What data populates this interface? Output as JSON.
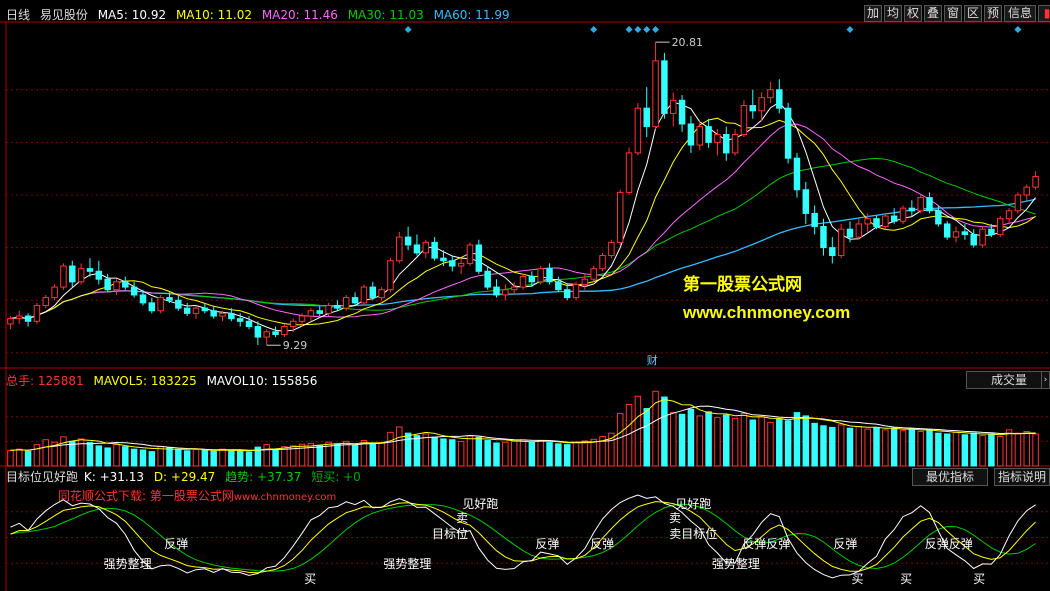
{
  "header": {
    "period": "日线",
    "stock_name": "易见股份",
    "ma": [
      {
        "label": "MA5: 10.92",
        "color": "#ffffff"
      },
      {
        "label": "MA10: 11.02",
        "color": "#ffff00"
      },
      {
        "label": "MA20: 11.46",
        "color": "#ff66ff"
      },
      {
        "label": "MA30: 11.03",
        "color": "#00cc00"
      },
      {
        "label": "MA60: 11.99",
        "color": "#33bbff"
      }
    ]
  },
  "toolbar": {
    "buttons": [
      "加",
      "均",
      "权",
      "叠",
      "窗",
      "区",
      "预",
      "信息"
    ],
    "flags": [
      "▮",
      "▮"
    ]
  },
  "watermark": {
    "line1": "第一股票公式网",
    "line2": "www.chnmoney.com",
    "color": "#ffff00"
  },
  "volume_panel": {
    "label_total": "总手: 125881",
    "label_mavol5": "MAVOL5: 183225",
    "label_mavol10": "MAVOL10: 155856",
    "selector": "成交量"
  },
  "indicator_panel": {
    "name": "目标位见好跑",
    "k": "K: +31.13",
    "d": "D: +29.47",
    "trend": "趋势: +37.37",
    "short_buy": "短买: +0",
    "btn_optimal": "最优指标",
    "btn_desc": "指标说明",
    "promo_red": "同花顺公式下载: 第一股票公式网",
    "promo_url": "www.chnmoney.com"
  },
  "chart_data": {
    "type": "candlestick",
    "price_annotations": {
      "high": "20.81",
      "low": "9.29"
    },
    "finance_marker": "财",
    "ohlc_series": [
      [
        10.1,
        10.4,
        9.9,
        10.3
      ],
      [
        10.3,
        10.6,
        10.1,
        10.4
      ],
      [
        10.4,
        10.5,
        10.0,
        10.2
      ],
      [
        10.2,
        10.9,
        10.1,
        10.8
      ],
      [
        10.8,
        11.2,
        10.7,
        11.1
      ],
      [
        11.1,
        11.6,
        11.0,
        11.5
      ],
      [
        11.5,
        12.4,
        11.4,
        12.3
      ],
      [
        12.3,
        12.5,
        11.5,
        11.7
      ],
      [
        11.7,
        12.4,
        11.6,
        12.2
      ],
      [
        12.2,
        12.6,
        11.9,
        12.1
      ],
      [
        12.1,
        12.5,
        11.6,
        11.8
      ],
      [
        11.8,
        12.0,
        11.3,
        11.4
      ],
      [
        11.4,
        11.8,
        11.2,
        11.7
      ],
      [
        11.7,
        11.9,
        11.4,
        11.5
      ],
      [
        11.5,
        11.7,
        11.1,
        11.2
      ],
      [
        11.2,
        11.4,
        10.8,
        10.9
      ],
      [
        10.9,
        11.1,
        10.5,
        10.6
      ],
      [
        10.6,
        11.2,
        10.5,
        11.1
      ],
      [
        11.1,
        11.3,
        10.9,
        11.0
      ],
      [
        11.0,
        11.2,
        10.6,
        10.7
      ],
      [
        10.7,
        10.9,
        10.4,
        10.5
      ],
      [
        10.5,
        10.8,
        10.3,
        10.7
      ],
      [
        10.7,
        10.9,
        10.5,
        10.6
      ],
      [
        10.6,
        10.8,
        10.3,
        10.4
      ],
      [
        10.4,
        10.6,
        10.2,
        10.5
      ],
      [
        10.5,
        10.7,
        10.2,
        10.3
      ],
      [
        10.3,
        10.5,
        10.0,
        10.2
      ],
      [
        10.2,
        10.4,
        9.9,
        10.0
      ],
      [
        10.0,
        10.2,
        9.3,
        9.6
      ],
      [
        9.6,
        9.9,
        9.29,
        9.8
      ],
      [
        9.8,
        10.0,
        9.6,
        9.7
      ],
      [
        9.7,
        10.1,
        9.6,
        10.0
      ],
      [
        10.0,
        10.3,
        9.8,
        10.2
      ],
      [
        10.2,
        10.5,
        10.0,
        10.4
      ],
      [
        10.4,
        10.7,
        10.2,
        10.6
      ],
      [
        10.6,
        10.8,
        10.4,
        10.5
      ],
      [
        10.5,
        10.9,
        10.4,
        10.8
      ],
      [
        10.8,
        11.0,
        10.6,
        10.7
      ],
      [
        10.7,
        11.2,
        10.6,
        11.1
      ],
      [
        11.1,
        11.3,
        10.8,
        10.9
      ],
      [
        10.9,
        11.6,
        10.8,
        11.5
      ],
      [
        11.5,
        11.7,
        11.0,
        11.1
      ],
      [
        11.1,
        11.5,
        11.0,
        11.4
      ],
      [
        11.4,
        12.6,
        11.3,
        12.5
      ],
      [
        12.5,
        13.6,
        12.4,
        13.4
      ],
      [
        13.4,
        13.8,
        12.9,
        13.1
      ],
      [
        13.1,
        13.5,
        12.7,
        12.8
      ],
      [
        12.8,
        13.3,
        12.6,
        13.2
      ],
      [
        13.2,
        13.4,
        12.5,
        12.6
      ],
      [
        12.6,
        12.9,
        12.3,
        12.5
      ],
      [
        12.5,
        12.7,
        12.1,
        12.3
      ],
      [
        12.3,
        12.6,
        12.0,
        12.4
      ],
      [
        12.4,
        13.2,
        12.3,
        13.1
      ],
      [
        13.1,
        13.3,
        12.0,
        12.1
      ],
      [
        12.1,
        12.3,
        11.4,
        11.5
      ],
      [
        11.5,
        11.8,
        11.1,
        11.2
      ],
      [
        11.2,
        11.6,
        11.0,
        11.4
      ],
      [
        11.4,
        11.7,
        11.2,
        11.5
      ],
      [
        11.5,
        12.0,
        11.4,
        11.9
      ],
      [
        11.9,
        12.1,
        11.5,
        11.7
      ],
      [
        11.7,
        12.3,
        11.6,
        12.2
      ],
      [
        12.2,
        12.4,
        11.6,
        11.7
      ],
      [
        11.7,
        11.9,
        11.3,
        11.4
      ],
      [
        11.4,
        11.6,
        11.0,
        11.1
      ],
      [
        11.1,
        11.7,
        11.0,
        11.6
      ],
      [
        11.6,
        12.0,
        11.4,
        11.8
      ],
      [
        11.8,
        12.3,
        11.7,
        12.2
      ],
      [
        12.2,
        12.8,
        12.1,
        12.7
      ],
      [
        12.7,
        13.3,
        12.6,
        13.2
      ],
      [
        13.2,
        15.2,
        13.1,
        15.1
      ],
      [
        15.1,
        16.8,
        15.0,
        16.6
      ],
      [
        16.6,
        18.5,
        16.5,
        18.3
      ],
      [
        18.3,
        19.1,
        17.2,
        17.6
      ],
      [
        17.6,
        20.81,
        17.5,
        20.1
      ],
      [
        20.1,
        20.4,
        17.9,
        18.1
      ],
      [
        18.1,
        18.9,
        17.6,
        18.6
      ],
      [
        18.6,
        18.8,
        17.4,
        17.7
      ],
      [
        17.7,
        18.0,
        16.6,
        16.9
      ],
      [
        16.9,
        17.8,
        16.7,
        17.6
      ],
      [
        17.6,
        17.9,
        16.8,
        17.0
      ],
      [
        17.0,
        17.5,
        16.5,
        17.3
      ],
      [
        17.3,
        17.6,
        16.3,
        16.6
      ],
      [
        16.6,
        17.5,
        16.5,
        17.3
      ],
      [
        17.3,
        18.6,
        17.2,
        18.4
      ],
      [
        18.4,
        19.0,
        17.9,
        18.2
      ],
      [
        18.2,
        18.9,
        17.8,
        18.7
      ],
      [
        18.7,
        19.3,
        18.5,
        19.0
      ],
      [
        19.0,
        19.4,
        18.1,
        18.3
      ],
      [
        18.3,
        18.5,
        16.2,
        16.4
      ],
      [
        16.4,
        16.6,
        14.9,
        15.2
      ],
      [
        15.2,
        15.5,
        13.9,
        14.3
      ],
      [
        14.3,
        14.6,
        13.5,
        13.8
      ],
      [
        13.8,
        14.1,
        12.7,
        13.0
      ],
      [
        13.0,
        13.4,
        12.4,
        12.7
      ],
      [
        12.7,
        13.9,
        12.6,
        13.7
      ],
      [
        13.7,
        14.0,
        13.2,
        13.4
      ],
      [
        13.4,
        14.1,
        13.3,
        13.9
      ],
      [
        13.9,
        14.3,
        13.6,
        14.1
      ],
      [
        14.1,
        14.2,
        13.7,
        13.8
      ],
      [
        13.8,
        14.3,
        13.7,
        14.2
      ],
      [
        14.2,
        14.5,
        13.9,
        14.0
      ],
      [
        14.0,
        14.6,
        13.9,
        14.5
      ],
      [
        14.5,
        14.8,
        14.2,
        14.4
      ],
      [
        14.4,
        15.0,
        14.3,
        14.9
      ],
      [
        14.9,
        15.1,
        14.3,
        14.4
      ],
      [
        14.4,
        14.6,
        13.8,
        13.9
      ],
      [
        13.9,
        14.0,
        13.3,
        13.4
      ],
      [
        13.4,
        13.8,
        13.2,
        13.6
      ],
      [
        13.6,
        13.9,
        13.3,
        13.5
      ],
      [
        13.5,
        13.7,
        13.0,
        13.1
      ],
      [
        13.1,
        13.8,
        13.0,
        13.7
      ],
      [
        13.7,
        13.9,
        13.4,
        13.5
      ],
      [
        13.5,
        14.2,
        13.4,
        14.1
      ],
      [
        14.1,
        14.5,
        13.9,
        14.4
      ],
      [
        14.4,
        15.1,
        14.3,
        15.0
      ],
      [
        15.0,
        15.4,
        14.8,
        15.3
      ],
      [
        15.3,
        15.9,
        15.2,
        15.7
      ]
    ],
    "vol_series": [
      38,
      41,
      36,
      52,
      64,
      58,
      71,
      60,
      66,
      57,
      49,
      44,
      52,
      47,
      41,
      39,
      35,
      47,
      44,
      40,
      37,
      40,
      38,
      36,
      41,
      38,
      36,
      34,
      46,
      52,
      40,
      47,
      49,
      53,
      55,
      50,
      58,
      54,
      60,
      50,
      62,
      55,
      57,
      82,
      95,
      80,
      74,
      78,
      70,
      66,
      64,
      60,
      73,
      70,
      62,
      56,
      58,
      60,
      64,
      58,
      62,
      57,
      54,
      52,
      58,
      61,
      65,
      72,
      80,
      128,
      150,
      170,
      140,
      182,
      168,
      130,
      126,
      138,
      122,
      132,
      118,
      124,
      116,
      128,
      112,
      120,
      106,
      114,
      110,
      130,
      122,
      104,
      98,
      94,
      100,
      92,
      96,
      90,
      94,
      88,
      92,
      86,
      90,
      84,
      88,
      80,
      78,
      82,
      76,
      80,
      74,
      78,
      72,
      88,
      80,
      84,
      78
    ],
    "vol_ylim": [
      0,
      190
    ],
    "price_ylim": [
      8.5,
      21.5
    ],
    "indicator_ylim": [
      0,
      100
    ],
    "signals": {
      "strong_consolidation": "强势整理",
      "rebound": "反弹",
      "target": "目标位",
      "sell": "卖",
      "buy": "买",
      "take_profit": "见好跑",
      "sell_target": "卖目标位",
      "rebound_rebound": "反弹反弹"
    },
    "colors": {
      "up": "#ff3333",
      "down": "#33ffff",
      "grid": "#800000",
      "ma5": "#ffffff",
      "ma10": "#ffff00",
      "ma20": "#ff66ff",
      "ma30": "#00cc00",
      "ma60": "#33bbff",
      "k_line": "#ffffff",
      "d_line": "#ffff00",
      "trend_line": "#00cc00"
    }
  }
}
